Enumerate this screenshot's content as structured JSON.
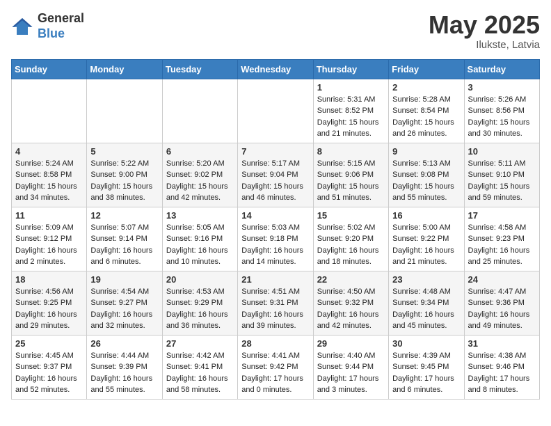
{
  "header": {
    "logo_general": "General",
    "logo_blue": "Blue",
    "month_year": "May 2025",
    "location": "Ilukste, Latvia"
  },
  "days_of_week": [
    "Sunday",
    "Monday",
    "Tuesday",
    "Wednesday",
    "Thursday",
    "Friday",
    "Saturday"
  ],
  "weeks": [
    [
      {
        "day": "",
        "info": ""
      },
      {
        "day": "",
        "info": ""
      },
      {
        "day": "",
        "info": ""
      },
      {
        "day": "",
        "info": ""
      },
      {
        "day": "1",
        "info": "Sunrise: 5:31 AM\nSunset: 8:52 PM\nDaylight: 15 hours\nand 21 minutes."
      },
      {
        "day": "2",
        "info": "Sunrise: 5:28 AM\nSunset: 8:54 PM\nDaylight: 15 hours\nand 26 minutes."
      },
      {
        "day": "3",
        "info": "Sunrise: 5:26 AM\nSunset: 8:56 PM\nDaylight: 15 hours\nand 30 minutes."
      }
    ],
    [
      {
        "day": "4",
        "info": "Sunrise: 5:24 AM\nSunset: 8:58 PM\nDaylight: 15 hours\nand 34 minutes."
      },
      {
        "day": "5",
        "info": "Sunrise: 5:22 AM\nSunset: 9:00 PM\nDaylight: 15 hours\nand 38 minutes."
      },
      {
        "day": "6",
        "info": "Sunrise: 5:20 AM\nSunset: 9:02 PM\nDaylight: 15 hours\nand 42 minutes."
      },
      {
        "day": "7",
        "info": "Sunrise: 5:17 AM\nSunset: 9:04 PM\nDaylight: 15 hours\nand 46 minutes."
      },
      {
        "day": "8",
        "info": "Sunrise: 5:15 AM\nSunset: 9:06 PM\nDaylight: 15 hours\nand 51 minutes."
      },
      {
        "day": "9",
        "info": "Sunrise: 5:13 AM\nSunset: 9:08 PM\nDaylight: 15 hours\nand 55 minutes."
      },
      {
        "day": "10",
        "info": "Sunrise: 5:11 AM\nSunset: 9:10 PM\nDaylight: 15 hours\nand 59 minutes."
      }
    ],
    [
      {
        "day": "11",
        "info": "Sunrise: 5:09 AM\nSunset: 9:12 PM\nDaylight: 16 hours\nand 2 minutes."
      },
      {
        "day": "12",
        "info": "Sunrise: 5:07 AM\nSunset: 9:14 PM\nDaylight: 16 hours\nand 6 minutes."
      },
      {
        "day": "13",
        "info": "Sunrise: 5:05 AM\nSunset: 9:16 PM\nDaylight: 16 hours\nand 10 minutes."
      },
      {
        "day": "14",
        "info": "Sunrise: 5:03 AM\nSunset: 9:18 PM\nDaylight: 16 hours\nand 14 minutes."
      },
      {
        "day": "15",
        "info": "Sunrise: 5:02 AM\nSunset: 9:20 PM\nDaylight: 16 hours\nand 18 minutes."
      },
      {
        "day": "16",
        "info": "Sunrise: 5:00 AM\nSunset: 9:22 PM\nDaylight: 16 hours\nand 21 minutes."
      },
      {
        "day": "17",
        "info": "Sunrise: 4:58 AM\nSunset: 9:23 PM\nDaylight: 16 hours\nand 25 minutes."
      }
    ],
    [
      {
        "day": "18",
        "info": "Sunrise: 4:56 AM\nSunset: 9:25 PM\nDaylight: 16 hours\nand 29 minutes."
      },
      {
        "day": "19",
        "info": "Sunrise: 4:54 AM\nSunset: 9:27 PM\nDaylight: 16 hours\nand 32 minutes."
      },
      {
        "day": "20",
        "info": "Sunrise: 4:53 AM\nSunset: 9:29 PM\nDaylight: 16 hours\nand 36 minutes."
      },
      {
        "day": "21",
        "info": "Sunrise: 4:51 AM\nSunset: 9:31 PM\nDaylight: 16 hours\nand 39 minutes."
      },
      {
        "day": "22",
        "info": "Sunrise: 4:50 AM\nSunset: 9:32 PM\nDaylight: 16 hours\nand 42 minutes."
      },
      {
        "day": "23",
        "info": "Sunrise: 4:48 AM\nSunset: 9:34 PM\nDaylight: 16 hours\nand 45 minutes."
      },
      {
        "day": "24",
        "info": "Sunrise: 4:47 AM\nSunset: 9:36 PM\nDaylight: 16 hours\nand 49 minutes."
      }
    ],
    [
      {
        "day": "25",
        "info": "Sunrise: 4:45 AM\nSunset: 9:37 PM\nDaylight: 16 hours\nand 52 minutes."
      },
      {
        "day": "26",
        "info": "Sunrise: 4:44 AM\nSunset: 9:39 PM\nDaylight: 16 hours\nand 55 minutes."
      },
      {
        "day": "27",
        "info": "Sunrise: 4:42 AM\nSunset: 9:41 PM\nDaylight: 16 hours\nand 58 minutes."
      },
      {
        "day": "28",
        "info": "Sunrise: 4:41 AM\nSunset: 9:42 PM\nDaylight: 17 hours\nand 0 minutes."
      },
      {
        "day": "29",
        "info": "Sunrise: 4:40 AM\nSunset: 9:44 PM\nDaylight: 17 hours\nand 3 minutes."
      },
      {
        "day": "30",
        "info": "Sunrise: 4:39 AM\nSunset: 9:45 PM\nDaylight: 17 hours\nand 6 minutes."
      },
      {
        "day": "31",
        "info": "Sunrise: 4:38 AM\nSunset: 9:46 PM\nDaylight: 17 hours\nand 8 minutes."
      }
    ]
  ]
}
